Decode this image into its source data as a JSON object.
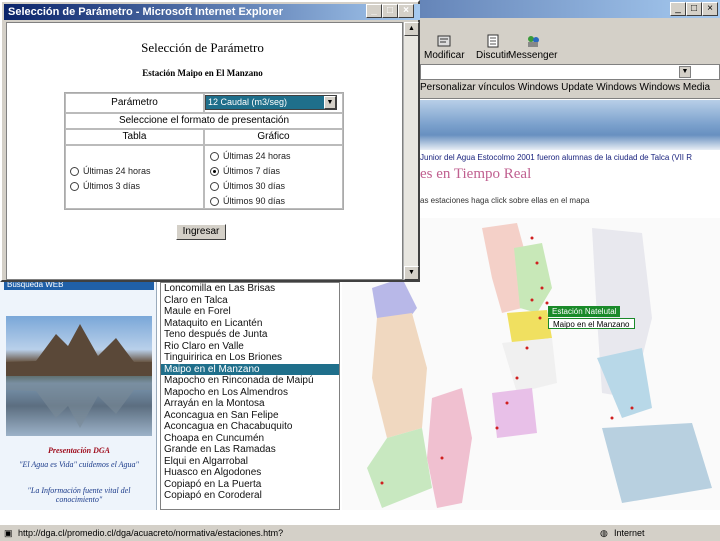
{
  "browser": {
    "toolbar": [
      {
        "label": "Modificar",
        "icon": "edit-icon"
      },
      {
        "label": "Discutir",
        "icon": "discuss-icon"
      },
      {
        "label": "Messenger",
        "icon": "messenger-icon"
      }
    ],
    "links": "Personalizar vínculos   Windows Update   Windows   Windows Media",
    "status_url": "http://dga.cl/promedio.cl/dga/acuacreto/normativa/estaciones.htm?",
    "status_zone": "Internet"
  },
  "page": {
    "news": "Junior del Agua Estocolmo 2001 fueron alumnas de la ciudad de Talca (VII R",
    "headline": "es en Tiempo Real",
    "instructions": "as estaciones haga click sobre ellas en el mapa",
    "sidebar_head": "Búsqueda WEB",
    "presentation": "Presentación DGA",
    "quote1": "\"El Agua es Vida\" cuidemos el Agua\"",
    "quote2": "\"La Información fuente vital del conocimiento\""
  },
  "map": {
    "tag_station": "Estación Natelutal",
    "tag_selected": "Maipo en el Manzano"
  },
  "stations": [
    "Loncomilla en Las Brisas",
    "Claro en Talca",
    "Maule en Forel",
    "Mataquito en Licantén",
    "Teno después de Junta",
    "Rio Claro en Valle",
    "Tinguiririca en Los Briones",
    "Maipo en el Manzano",
    "Mapocho en Rinconada de Maipú",
    "Mapocho en Los Almendros",
    "Arrayán en la Montosa",
    "Aconcagua en San Felipe",
    "Aconcagua en Chacabuquito",
    "Choapa en Cuncumén",
    "Grande en Las Ramadas",
    "Elqui en Algarrobal",
    "Huasco en Algodones",
    "Copiapó en La Puerta",
    "Copiapó en Coroderal"
  ],
  "popup": {
    "title": "Selección de Parámetro - Microsoft Internet Explorer",
    "heading": "Selección de Parámetro",
    "station": "Estación Maipo en El Manzano",
    "param_label": "Parámetro",
    "param_value": "12 Caudal (m3/seg)",
    "format_label": "Seleccione el formato de presentación",
    "col_table": "Tabla",
    "col_chart": "Gráfico",
    "table_options": [
      "Últimas 24 horas",
      "Últimos 3 días"
    ],
    "chart_options": [
      "Últimas 24 horas",
      "Últimos 7 días",
      "Últimos 30 días",
      "Últimos 90 días"
    ],
    "submit": "Ingresar"
  }
}
